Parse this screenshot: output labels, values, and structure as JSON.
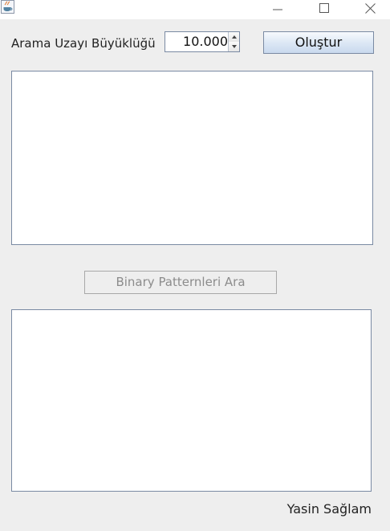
{
  "window": {
    "icons": {
      "app": "java-cup-icon",
      "minimize": "minimize-icon",
      "maximize": "maximize-icon",
      "close": "close-icon"
    }
  },
  "form": {
    "size_label": "Arama Uzayı Büyüklüğü",
    "size_value": "10.000",
    "create_button": "Oluştur",
    "search_button": "Binary Patternleri Ara",
    "top_output": "",
    "bottom_output": ""
  },
  "footer": {
    "author": "Yasin Sağlam"
  }
}
